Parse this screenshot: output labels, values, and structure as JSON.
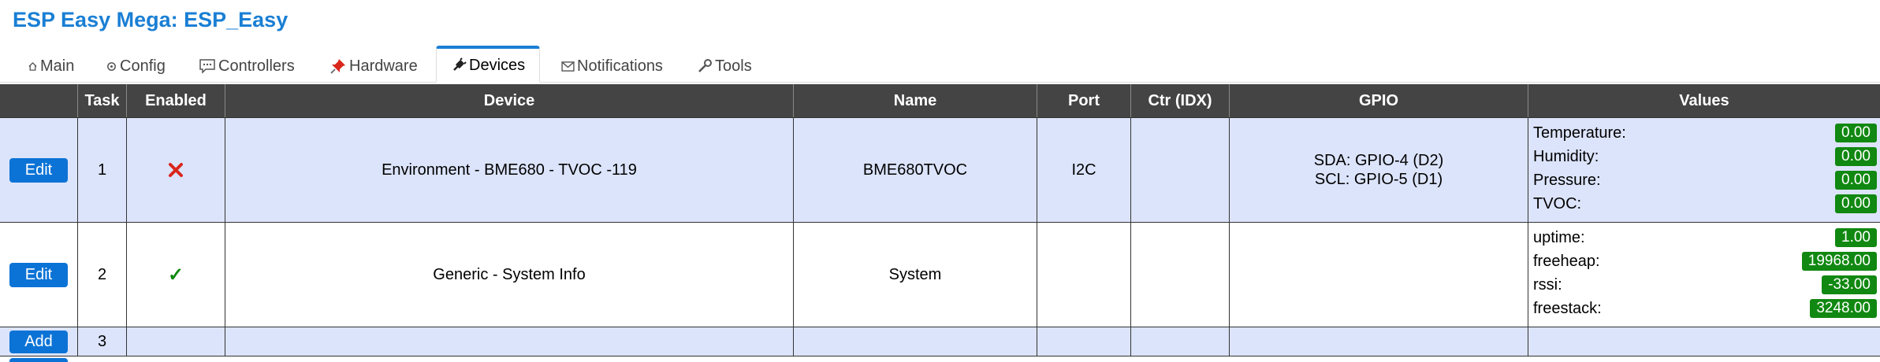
{
  "header": {
    "title": "ESP Easy Mega: ESP_Easy"
  },
  "tabs": [
    {
      "label": "Main",
      "icon": "home-icon"
    },
    {
      "label": "Config",
      "icon": "gear-icon"
    },
    {
      "label": "Controllers",
      "icon": "chat-icon"
    },
    {
      "label": "Hardware",
      "icon": "pin-icon"
    },
    {
      "label": "Devices",
      "icon": "plug-icon",
      "active": true
    },
    {
      "label": "Notifications",
      "icon": "mail-icon"
    },
    {
      "label": "Tools",
      "icon": "wrench-icon"
    }
  ],
  "table": {
    "headers": [
      "",
      "Task",
      "Enabled",
      "Device",
      "Name",
      "Port",
      "Ctr (IDX)",
      "GPIO",
      "Values"
    ],
    "rows": [
      {
        "button": "Edit",
        "task": "1",
        "enabled": false,
        "device": "Environment - BME680 - TVOC -119",
        "name": "BME680TVOC",
        "port": "I2C",
        "ctr": "",
        "gpio": [
          "SDA: GPIO-4 (D2)",
          "SCL: GPIO-5 (D1)"
        ],
        "values": [
          {
            "name": "Temperature:",
            "value": "0.00"
          },
          {
            "name": "Humidity:",
            "value": "0.00"
          },
          {
            "name": "Pressure:",
            "value": "0.00"
          },
          {
            "name": "TVOC:",
            "value": "0.00"
          }
        ]
      },
      {
        "button": "Edit",
        "task": "2",
        "enabled": true,
        "device": "Generic - System Info",
        "name": "System",
        "port": "",
        "ctr": "",
        "gpio": [],
        "values": [
          {
            "name": "uptime:",
            "value": "1.00"
          },
          {
            "name": "freeheap:",
            "value": "19968.00"
          },
          {
            "name": "rssi:",
            "value": "-33.00"
          },
          {
            "name": "freestack:",
            "value": "3248.00"
          }
        ]
      },
      {
        "button": "Add",
        "task": "3"
      }
    ]
  },
  "colors": {
    "accent": "#1a7fd4",
    "button": "#0c73d6",
    "header_bg": "#444444",
    "row_alt": "#dce4fb",
    "badge": "#118811",
    "disabled": "#d9271c"
  }
}
